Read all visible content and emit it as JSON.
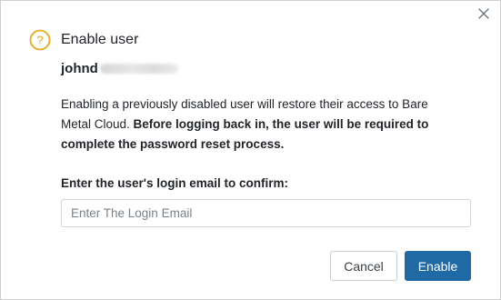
{
  "dialog": {
    "title": "Enable user",
    "user_visible": "johnd",
    "description_plain": "Enabling a previously disabled user will restore their access to Bare Metal Cloud. ",
    "description_bold": "Before logging back in, the user will be required to complete the password reset process.",
    "confirm_label": "Enter the user's login email to confirm:",
    "email_placeholder": "Enter The Login Email",
    "email_value": "",
    "cancel_label": "Cancel",
    "enable_label": "Enable"
  },
  "icons": {
    "close": "close-icon",
    "header": "question-circle-icon"
  },
  "colors": {
    "warning_icon": "#f0a818",
    "primary_button": "#1f6aa5",
    "text": "#212529"
  }
}
